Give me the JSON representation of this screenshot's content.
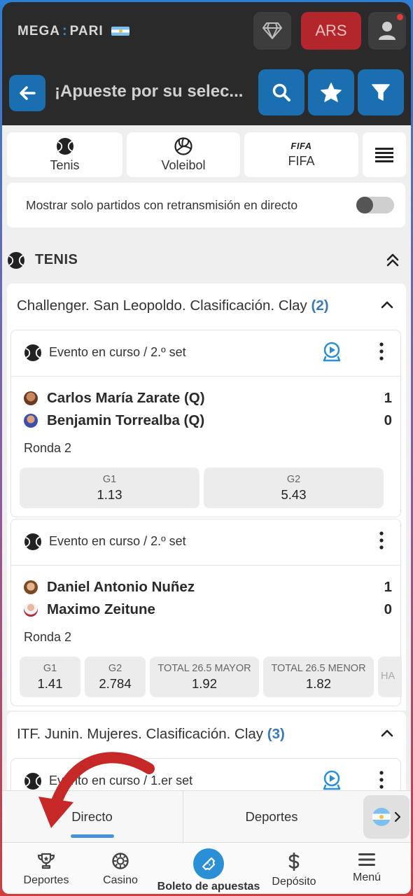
{
  "header": {
    "logo_left": "MEGA",
    "logo_right": "PARI",
    "currency": "ARS",
    "diamond_icon": "diamond-icon",
    "user_icon": "user-icon",
    "search_title": "¡Apueste por su selec..."
  },
  "sports_tabs": [
    {
      "label": "Tenis",
      "icon": "tennis-ball-icon"
    },
    {
      "label": "Voleibol",
      "icon": "volleyball-icon"
    },
    {
      "label": "FIFA",
      "icon": "fifa-logo"
    }
  ],
  "stream_toggle": {
    "label": "Mostrar solo partidos con retransmisión en directo",
    "on": false
  },
  "section": {
    "title": "TENIS"
  },
  "leagues": [
    {
      "name": "Challenger. San Leopoldo. Clasificación. Clay",
      "count": "(2)",
      "events": [
        {
          "status": "Evento en curso / 2.º set",
          "has_stream": true,
          "teams": [
            {
              "name": "Carlos María Zarate (Q)",
              "score": "1"
            },
            {
              "name": "Benjamin Torrealba (Q)",
              "score": "0"
            }
          ],
          "round": "Ronda 2",
          "odds": [
            {
              "label": "G1",
              "value": "1.13"
            },
            {
              "label": "G2",
              "value": "5.43"
            }
          ]
        },
        {
          "status": "Evento en curso / 2.º set",
          "has_stream": false,
          "teams": [
            {
              "name": "Daniel Antonio Nuñez",
              "score": "1"
            },
            {
              "name": "Maximo Zeitune",
              "score": "0"
            }
          ],
          "round": "Ronda 2",
          "odds": [
            {
              "label": "G1",
              "value": "1.41"
            },
            {
              "label": "G2",
              "value": "2.784"
            },
            {
              "label": "TOTAL 26.5 MAYOR",
              "value": "1.92"
            },
            {
              "label": "TOTAL 26.5 MENOR",
              "value": "1.82"
            },
            {
              "label": "HA",
              "value": ""
            }
          ]
        }
      ]
    },
    {
      "name": "ITF. Junin. Mujeres. Clasificación. Clay",
      "count": "(3)",
      "events": [
        {
          "status": "Evento en curso / 1.er set",
          "has_stream": true
        }
      ]
    }
  ],
  "bottom_tabs": {
    "directo": "Directo",
    "deportes": "Deportes"
  },
  "nav": [
    {
      "label": "Deportes",
      "icon": "trophy-icon"
    },
    {
      "label": "Casino",
      "icon": "casino-chip-icon"
    },
    {
      "label": "Boleto de apuestas",
      "icon": "ticket-icon"
    },
    {
      "label": "Depósito",
      "icon": "dollar-icon"
    },
    {
      "label": "Menú",
      "icon": "menu-icon"
    }
  ],
  "colors": {
    "accent_blue": "#1a6fb0",
    "currency_red": "#b3262c",
    "count_blue": "#3a78b8",
    "header_dark": "#2a2a2a",
    "annotation_arrow": "#c62828"
  }
}
